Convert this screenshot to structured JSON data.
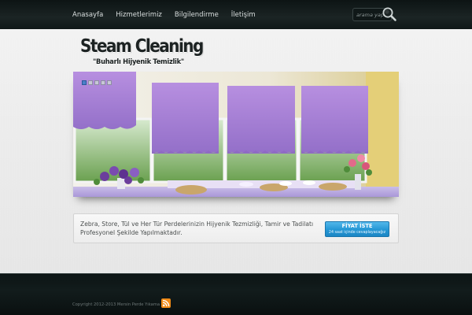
{
  "nav": {
    "items": [
      {
        "label": "Anasayfa"
      },
      {
        "label": "Hizmetlerimiz"
      },
      {
        "label": "Bilgilendirme"
      },
      {
        "label": "İletişim"
      }
    ]
  },
  "search": {
    "placeholder": "arama yapın"
  },
  "logo": {
    "title": "Steam Cleaning",
    "subtitle": "\"Buharlı Hijyenik Temizlik\""
  },
  "slider": {
    "slide_count": 5,
    "active_index": 0
  },
  "info": {
    "text": "Zebra, Store, Tül ve Her Tür Perdelerinizin Hijyenik Tezmizliği, Tamir ve Tadilatı Profesyonel Şekilde Yapılmaktadır.",
    "cta_title": "FİYAT İSTE",
    "cta_subtitle": "24 saat içinde cevaplayacağız"
  },
  "footer": {
    "copyright": "Copyright 2012-2013 Mersin Perde Yıkama"
  },
  "colors": {
    "header_bg": "#1b2424",
    "accent_blue": "#2496d4",
    "curtain_purple": "#a77fd6",
    "rss_orange": "#f08a16"
  },
  "icons": {
    "search": "search-icon",
    "rss": "rss-icon"
  }
}
